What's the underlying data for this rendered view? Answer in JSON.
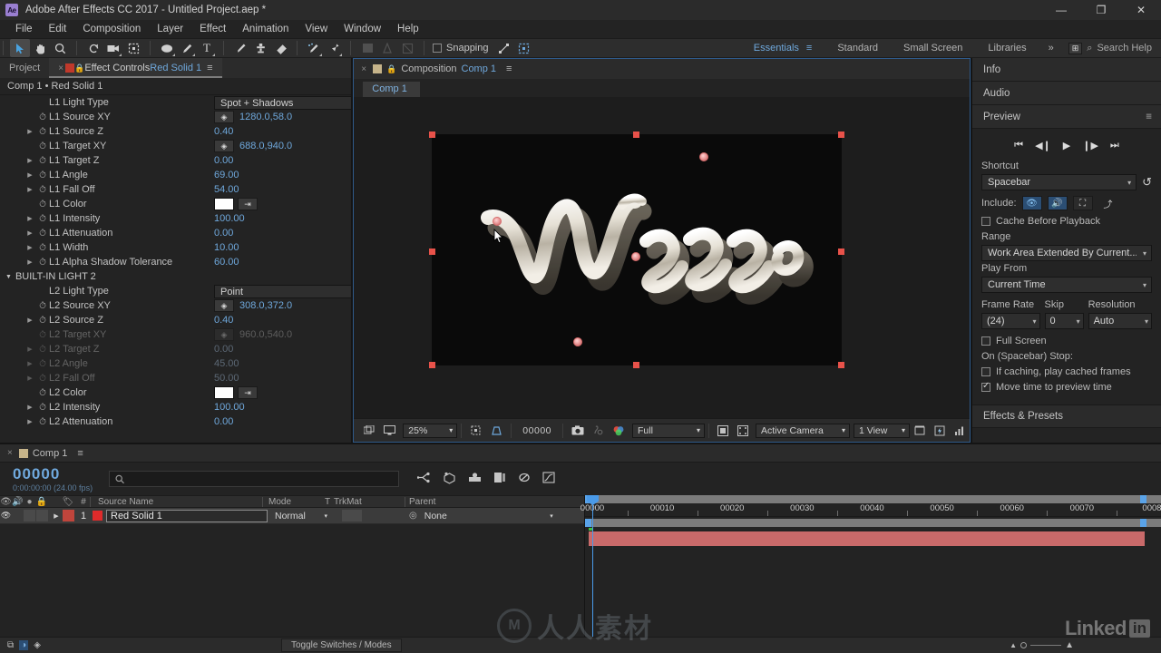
{
  "window": {
    "title": "Adobe After Effects CC 2017 - Untitled Project.aep *",
    "logo": "Ae",
    "minimize": "—",
    "maximize": "❐",
    "close": "✕"
  },
  "menu": [
    "File",
    "Edit",
    "Composition",
    "Layer",
    "Effect",
    "Animation",
    "View",
    "Window",
    "Help"
  ],
  "toolbar": {
    "snapping_label": "Snapping",
    "workspaces": [
      "Essentials",
      "Standard",
      "Small Screen",
      "Libraries"
    ],
    "active_workspace": "Essentials",
    "overflow": "»",
    "search_help": "Search Help"
  },
  "effect_controls": {
    "tabs": [
      {
        "label": "Project",
        "active": false
      },
      {
        "label": "Effect Controls",
        "suffix": "Red Solid 1",
        "active": true
      }
    ],
    "breadcrumb": "Comp 1 • Red Solid 1",
    "rows": [
      {
        "label": "L1 Light Type",
        "type": "select",
        "value": "Spot + Shadows",
        "indent": 1,
        "stopwatch": false,
        "twirl": false,
        "dim": false
      },
      {
        "label": "L1 Source XY",
        "type": "xy",
        "value": "1280.0,58.0",
        "indent": 2,
        "stopwatch": true,
        "twirl": false,
        "dim": false
      },
      {
        "label": "L1 Source Z",
        "type": "num",
        "value": "0.40",
        "indent": 2,
        "stopwatch": true,
        "twirl": true,
        "dim": false
      },
      {
        "label": "L1 Target XY",
        "type": "xy",
        "value": "688.0,940.0",
        "indent": 2,
        "stopwatch": true,
        "twirl": false,
        "dim": false
      },
      {
        "label": "L1 Target Z",
        "type": "num",
        "value": "0.00",
        "indent": 2,
        "stopwatch": true,
        "twirl": true,
        "dim": false
      },
      {
        "label": "L1 Angle",
        "type": "num",
        "value": "69.00",
        "indent": 2,
        "stopwatch": true,
        "twirl": true,
        "dim": false
      },
      {
        "label": "L1 Fall Off",
        "type": "num",
        "value": "54.00",
        "indent": 2,
        "stopwatch": true,
        "twirl": true,
        "dim": false
      },
      {
        "label": "L1 Color",
        "type": "color",
        "value": "#ffffff",
        "indent": 2,
        "stopwatch": true,
        "twirl": false,
        "dim": false
      },
      {
        "label": "L1 Intensity",
        "type": "num",
        "value": "100.00",
        "indent": 2,
        "stopwatch": true,
        "twirl": true,
        "dim": false
      },
      {
        "label": "L1 Attenuation",
        "type": "num",
        "value": "0.00",
        "indent": 2,
        "stopwatch": true,
        "twirl": true,
        "dim": false
      },
      {
        "label": "L1 Width",
        "type": "num",
        "value": "10.00",
        "indent": 2,
        "stopwatch": true,
        "twirl": true,
        "dim": false
      },
      {
        "label": "L1 Alpha Shadow Tolerance",
        "type": "num",
        "value": "60.00",
        "indent": 2,
        "stopwatch": true,
        "twirl": true,
        "dim": false
      },
      {
        "label": "BUILT-IN LIGHT 2",
        "type": "group",
        "value": "",
        "indent": 0,
        "stopwatch": false,
        "twirl": true,
        "dim": false
      },
      {
        "label": "L2 Light Type",
        "type": "select",
        "value": "Point",
        "indent": 1,
        "stopwatch": false,
        "twirl": false,
        "dim": false
      },
      {
        "label": "L2 Source XY",
        "type": "xy",
        "value": "308.0,372.0",
        "indent": 2,
        "stopwatch": true,
        "twirl": false,
        "dim": false
      },
      {
        "label": "L2 Source Z",
        "type": "num",
        "value": "0.40",
        "indent": 2,
        "stopwatch": true,
        "twirl": true,
        "dim": false
      },
      {
        "label": "L2 Target XY",
        "type": "xy",
        "value": "960.0,540.0",
        "indent": 2,
        "stopwatch": true,
        "twirl": false,
        "dim": true
      },
      {
        "label": "L2 Target Z",
        "type": "num",
        "value": "0.00",
        "indent": 2,
        "stopwatch": true,
        "twirl": true,
        "dim": true
      },
      {
        "label": "L2 Angle",
        "type": "num",
        "value": "45.00",
        "indent": 2,
        "stopwatch": true,
        "twirl": true,
        "dim": true
      },
      {
        "label": "L2 Fall Off",
        "type": "num",
        "value": "50.00",
        "indent": 2,
        "stopwatch": true,
        "twirl": true,
        "dim": true
      },
      {
        "label": "L2 Color",
        "type": "color",
        "value": "#ffffff",
        "indent": 2,
        "stopwatch": true,
        "twirl": false,
        "dim": false
      },
      {
        "label": "L2 Intensity",
        "type": "num",
        "value": "100.00",
        "indent": 2,
        "stopwatch": true,
        "twirl": true,
        "dim": false
      },
      {
        "label": "L2 Attenuation",
        "type": "num",
        "value": "0.00",
        "indent": 2,
        "stopwatch": true,
        "twirl": true,
        "dim": false
      }
    ]
  },
  "composition": {
    "tab_prefix": "Composition",
    "tab_name": "Comp 1",
    "subtab": "Comp 1",
    "viewer_toolbar": {
      "zoom": "25%",
      "timecode": "00000",
      "quality": "Full",
      "camera": "Active Camera",
      "views": "1 View"
    }
  },
  "right_panel": {
    "sections": [
      "Info",
      "Audio",
      "Preview"
    ],
    "preview_title": "Preview",
    "transport": [
      "⏮",
      "◀❙",
      "▶",
      "❙▶",
      "⏭"
    ],
    "shortcut_label": "Shortcut",
    "shortcut_value": "Spacebar",
    "include_label": "Include:",
    "cache_before_playback": "Cache Before Playback",
    "range_label": "Range",
    "range_value": "Work Area Extended By Current...",
    "play_from_label": "Play From",
    "play_from_value": "Current Time",
    "frame_rate_label": "Frame Rate",
    "frame_rate_value": "(24)",
    "skip_label": "Skip",
    "skip_value": "0",
    "resolution_label": "Resolution",
    "resolution_value": "Auto",
    "full_screen": "Full Screen",
    "on_stop_label": "On (Spacebar) Stop:",
    "if_caching": "If caching, play cached frames",
    "move_time": "Move time to preview time",
    "effects_presets": "Effects & Presets"
  },
  "timeline": {
    "tab_name": "Comp 1",
    "current_time": "00000",
    "current_time_sub": "0:00:00:00 (24.00 fps)",
    "search_placeholder": "",
    "columns": [
      "#",
      "Source Name",
      "Mode",
      "T",
      "TrkMat",
      "Parent"
    ],
    "layers": [
      {
        "index": "1",
        "name": "Red Solid 1",
        "mode": "Normal",
        "trkmat": "",
        "parent": "None",
        "color": "#e02b2b"
      }
    ],
    "ruler_labels": [
      "00000",
      "00010",
      "00020",
      "00030",
      "00040",
      "00050",
      "00060",
      "00070",
      "0008"
    ],
    "toggle_switches": "Toggle Switches / Modes"
  },
  "watermarks": {
    "linkedin_text": "Linked",
    "linkedin_badge": "in",
    "chinese": "人人素材"
  }
}
